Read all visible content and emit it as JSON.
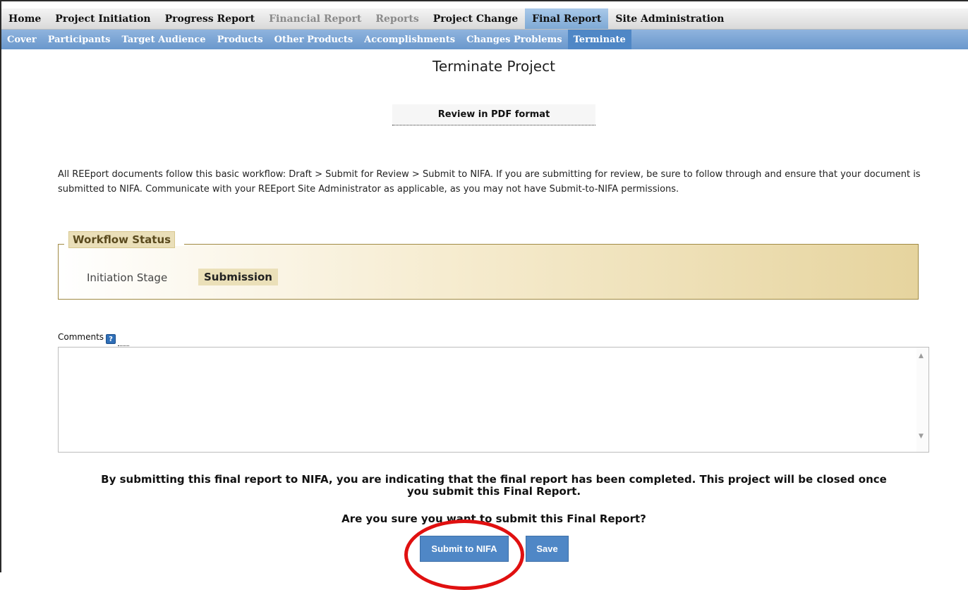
{
  "top_nav": [
    {
      "label": "Home",
      "state": "normal"
    },
    {
      "label": "Project Initiation",
      "state": "normal"
    },
    {
      "label": "Progress Report",
      "state": "normal"
    },
    {
      "label": "Financial Report",
      "state": "disabled"
    },
    {
      "label": "Reports",
      "state": "disabled"
    },
    {
      "label": "Project Change",
      "state": "normal"
    },
    {
      "label": "Final Report",
      "state": "active"
    },
    {
      "label": "Site Administration",
      "state": "normal"
    }
  ],
  "sub_nav": [
    {
      "label": "Cover",
      "state": "normal"
    },
    {
      "label": "Participants",
      "state": "normal"
    },
    {
      "label": "Target Audience",
      "state": "normal"
    },
    {
      "label": "Products",
      "state": "normal"
    },
    {
      "label": "Other Products",
      "state": "normal"
    },
    {
      "label": "Accomplishments",
      "state": "normal"
    },
    {
      "label": "Changes Problems",
      "state": "normal"
    },
    {
      "label": "Terminate",
      "state": "active"
    }
  ],
  "page": {
    "title": "Terminate Project",
    "pdf_link": "Review in PDF format",
    "intro": "All REEport documents follow this basic workflow:  Draft > Submit for Review > Submit to NIFA.  If you are submitting for review, be sure to follow through and ensure that your document is submitted to NIFA.  Communicate with your REEport Site Administrator as applicable, as you may not have Submit-to-NIFA permissions."
  },
  "workflow": {
    "legend": "Workflow Status",
    "stage_label": "Initiation Stage",
    "current": "Submission"
  },
  "comments": {
    "label": "Comments",
    "help_glyph": "?",
    "value": ""
  },
  "confirm": {
    "text_line1": "By submitting this final report to NIFA, you are indicating that the final report has been completed. This project will be closed once",
    "text_line2": "you submit this Final Report.",
    "question": "Are you sure you want to submit this Final Report?"
  },
  "buttons": {
    "submit": "Submit to NIFA",
    "save": "Save"
  },
  "colors": {
    "nav_active": "#7ea9d5",
    "subnav": "#6a98cc",
    "button": "#4f87c6",
    "annotation_circle": "#e01010",
    "workflow_gold": "#e6d49e"
  }
}
